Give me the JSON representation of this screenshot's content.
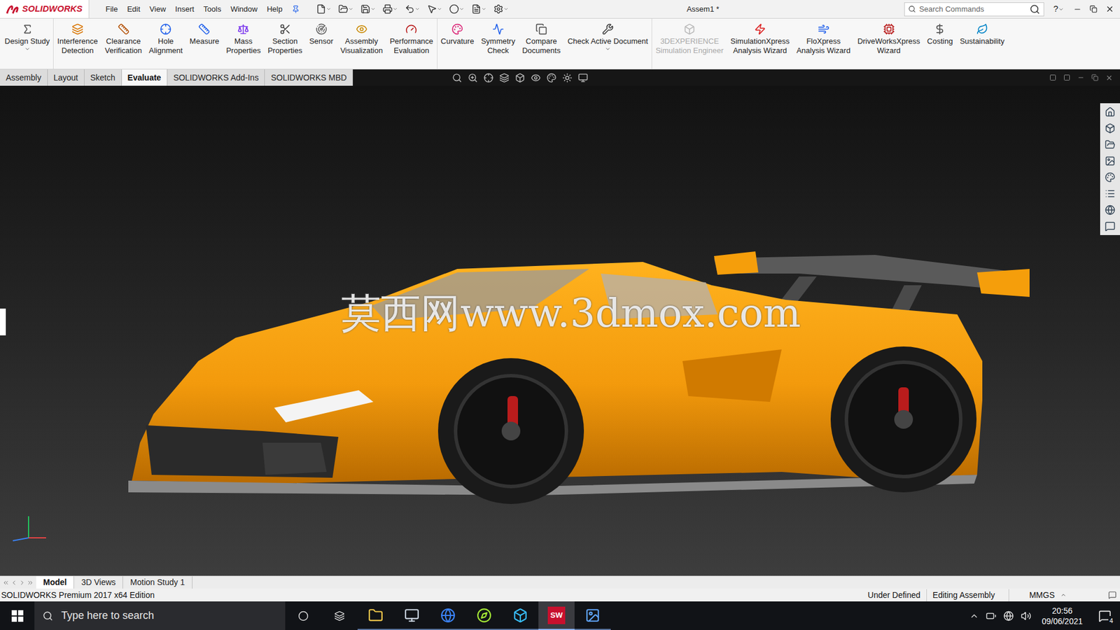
{
  "app": {
    "logo": "SOLIDWORKS",
    "menu": [
      "File",
      "Edit",
      "View",
      "Insert",
      "Tools",
      "Window",
      "Help"
    ],
    "title": "Assem1 *",
    "search_placeholder": "Search Commands",
    "help": "?"
  },
  "ribbon": {
    "groups": [
      [
        {
          "lines": [
            "Design Study"
          ],
          "dropdown": true,
          "disabled": false
        }
      ],
      [
        {
          "lines": [
            "Interference",
            "Detection"
          ],
          "dropdown": false,
          "disabled": false
        },
        {
          "lines": [
            "Clearance",
            "Verification"
          ],
          "dropdown": false,
          "disabled": false
        },
        {
          "lines": [
            "Hole",
            "Alignment"
          ],
          "dropdown": false,
          "disabled": false
        },
        {
          "lines": [
            "Measure"
          ],
          "dropdown": false,
          "disabled": false
        },
        {
          "lines": [
            "Mass",
            "Properties"
          ],
          "dropdown": false,
          "disabled": false
        },
        {
          "lines": [
            "Section",
            "Properties"
          ],
          "dropdown": false,
          "disabled": false
        },
        {
          "lines": [
            "Sensor"
          ],
          "dropdown": false,
          "disabled": false
        },
        {
          "lines": [
            "Assembly",
            "Visualization"
          ],
          "dropdown": false,
          "disabled": false
        },
        {
          "lines": [
            "Performance",
            "Evaluation"
          ],
          "dropdown": false,
          "disabled": false
        }
      ],
      [
        {
          "lines": [
            "Curvature"
          ],
          "dropdown": false,
          "disabled": false
        },
        {
          "lines": [
            "Symmetry",
            "Check"
          ],
          "dropdown": false,
          "disabled": false
        },
        {
          "lines": [
            "Compare",
            "Documents"
          ],
          "dropdown": false,
          "disabled": false
        },
        {
          "lines": [
            "Check Active Document"
          ],
          "dropdown": true,
          "disabled": false
        }
      ],
      [
        {
          "lines": [
            "3DEXPERIENCE",
            "Simulation Engineer"
          ],
          "dropdown": false,
          "disabled": true
        },
        {
          "lines": [
            "SimulationXpress",
            "Analysis Wizard"
          ],
          "dropdown": false,
          "disabled": false
        },
        {
          "lines": [
            "FloXpress",
            "Analysis Wizard"
          ],
          "dropdown": false,
          "disabled": false
        },
        {
          "lines": [
            "DriveWorksXpress",
            "Wizard"
          ],
          "dropdown": false,
          "disabled": false
        },
        {
          "lines": [
            "Costing"
          ],
          "dropdown": false,
          "disabled": false
        },
        {
          "lines": [
            "Sustainability"
          ],
          "dropdown": false,
          "disabled": false
        }
      ]
    ]
  },
  "tabs": [
    {
      "label": "Assembly",
      "selected": false
    },
    {
      "label": "Layout",
      "selected": false
    },
    {
      "label": "Sketch",
      "selected": false
    },
    {
      "label": "Evaluate",
      "selected": true
    },
    {
      "label": "SOLIDWORKS Add-Ins",
      "selected": false
    },
    {
      "label": "SOLIDWORKS MBD",
      "selected": false
    }
  ],
  "graphics": {
    "watermark": "莫西网www.3dmox.com"
  },
  "bottom_tabs": [
    {
      "label": "Model",
      "selected": true
    },
    {
      "label": "3D Views",
      "selected": false
    },
    {
      "label": "Motion Study 1",
      "selected": false
    }
  ],
  "status_bar": {
    "edition": "SOLIDWORKS Premium 2017 x64 Edition",
    "state": "Under Defined",
    "mode": "Editing Assembly",
    "units": "MMGS"
  },
  "taskbar": {
    "search_placeholder": "Type here to search",
    "time": "20:56",
    "date": "09/06/2021",
    "notifications": "4",
    "apps": [
      {
        "label": "",
        "selected": false
      },
      {
        "label": "",
        "selected": false
      },
      {
        "label": "",
        "selected": false
      },
      {
        "label": "",
        "selected": false
      },
      {
        "label": "",
        "selected": false
      },
      {
        "label": "SW",
        "selected": true
      },
      {
        "label": "",
        "selected": false
      }
    ]
  }
}
